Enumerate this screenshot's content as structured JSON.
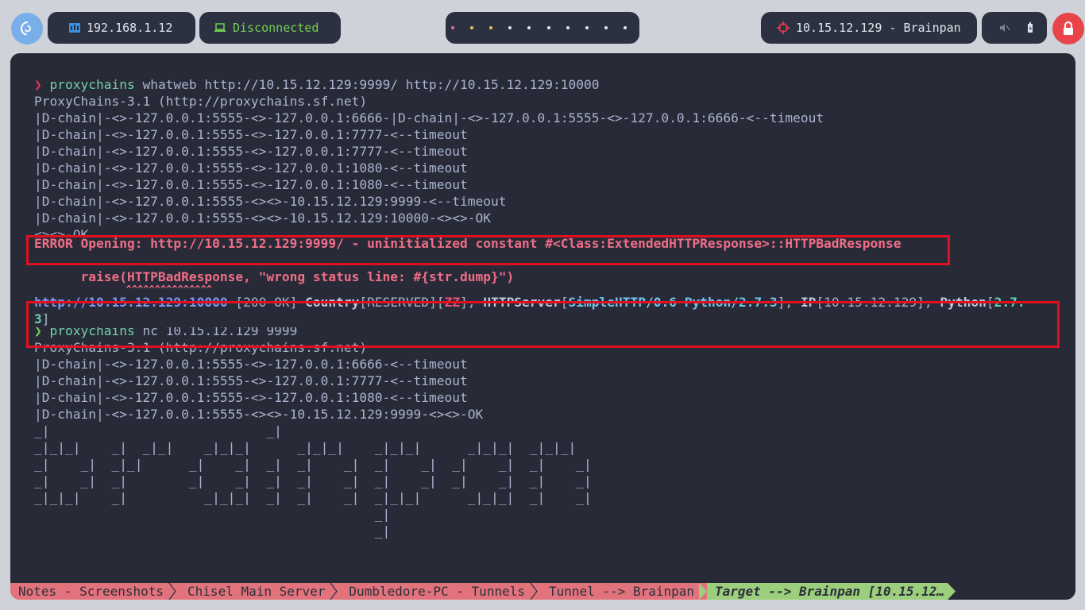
{
  "topbar": {
    "ip_local": "192.168.1.12",
    "vpn_status": "Disconnected",
    "workspaces": 10,
    "target": "10.15.12.129 - Brainpan"
  },
  "colors": {
    "accent": "#7aaee8",
    "lock": "#e8454a",
    "vpn_green": "#74d152",
    "terminal_bg": "#282b37",
    "highlight_box": "#e01020",
    "status_inactive": "#e2737c",
    "status_active": "#9ccf7c"
  },
  "terminal": {
    "cmd1": {
      "prompt": "❯",
      "bin": "proxychains",
      "args": " whatweb http://10.15.12.129:9999/ http://10.15.12.129:10000"
    },
    "block1": [
      "ProxyChains-3.1 (http://proxychains.sf.net)",
      "|D-chain|-<>-127.0.0.1:5555-<>-127.0.0.1:6666-|D-chain|-<>-127.0.0.1:5555-<>-127.0.0.1:6666-<--timeout",
      "|D-chain|-<>-127.0.0.1:5555-<>-127.0.0.1:7777-<--timeout",
      "|D-chain|-<>-127.0.0.1:5555-<>-127.0.0.1:7777-<--timeout",
      "|D-chain|-<>-127.0.0.1:5555-<>-127.0.0.1:1080-<--timeout",
      "|D-chain|-<>-127.0.0.1:5555-<>-127.0.0.1:1080-<--timeout",
      "|D-chain|-<>-127.0.0.1:5555-<><>-10.15.12.129:9999-<--timeout",
      "|D-chain|-<>-127.0.0.1:5555-<><>-10.15.12.129:10000-<><>-OK",
      "<><>-OK"
    ],
    "error_line": "ERROR Opening: http://10.15.12.129:9999/ - uninitialized constant #<Class:ExtendedHTTPResponse>::HTTPBadResponse",
    "raise_line": "      raise(HTTPBadResponse, \"wrong status line: #{str.dump}\")",
    "caret_line": "                ^^^^^^^^^^^^^^^",
    "result": {
      "url": "http://10.15.12.129:10000",
      "status": " [200 OK] ",
      "country_k": "Country",
      "country_v1": "RESERVED",
      "country_v2": "ZZ",
      "server_k": "HTTPServer",
      "server_v": "SimpleHTTP/0.6 Python/2.7.3",
      "ip_k": "IP",
      "ip_v": "10.15.12.129",
      "py_k": "Python",
      "py_v1": "2.7.",
      "py_v2": "3"
    },
    "cmd2": {
      "prompt": "❯",
      "bin": "proxychains",
      "args": " nc 10.15.12.129 9999"
    },
    "block2": [
      "ProxyChains-3.1 (http://proxychains.sf.net)",
      "|D-chain|-<>-127.0.0.1:5555-<>-127.0.0.1:6666-<--timeout",
      "|D-chain|-<>-127.0.0.1:5555-<>-127.0.0.1:7777-<--timeout",
      "|D-chain|-<>-127.0.0.1:5555-<>-127.0.0.1:1080-<--timeout",
      "|D-chain|-<>-127.0.0.1:5555-<><>-10.15.12.129:9999-<><>-OK"
    ],
    "banner": [
      "_|                            _|",
      "_|_|_|    _|  _|_|    _|_|_|      _|_|_|    _|_|_|      _|_|_|  _|_|_|",
      "_|    _|  _|_|      _|    _|  _|  _|    _|  _|    _|  _|    _|  _|    _|",
      "_|    _|  _|        _|    _|  _|  _|    _|  _|    _|  _|    _|  _|    _|",
      "_|_|_|    _|          _|_|_|  _|  _|    _|  _|_|_|      _|_|_|  _|    _|",
      "                                            _|",
      "                                            _|"
    ]
  },
  "status_bar": [
    "Notes - Screenshots",
    "Chisel Main Server",
    "Dumbledore-PC - Tunnels",
    "Tunnel --> Brainpan",
    "Target --> Brainpan [10.15.12…"
  ]
}
